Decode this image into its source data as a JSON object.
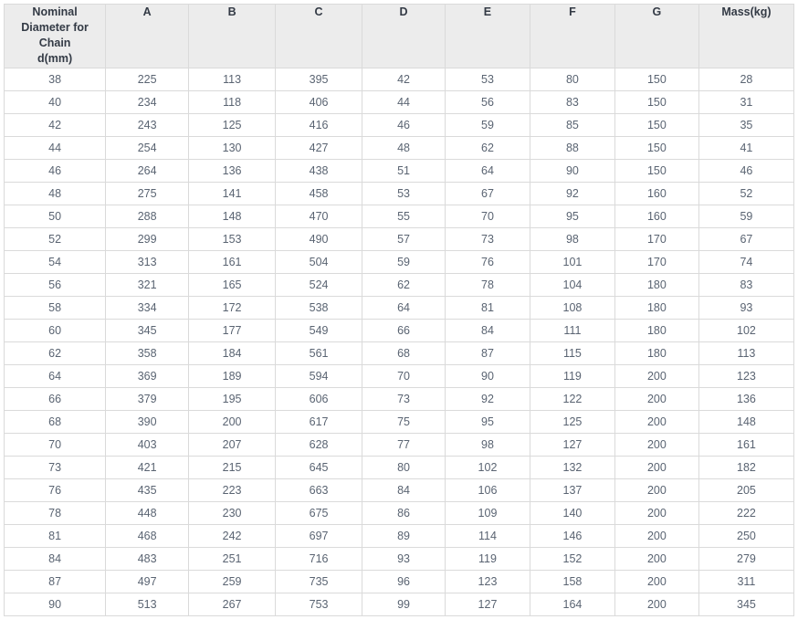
{
  "table": {
    "headers": [
      "Nominal Diameter for Chain d(mm)",
      "A",
      "B",
      "C",
      "D",
      "E",
      "F",
      "G",
      "Mass(kg)"
    ],
    "header_first_lines": [
      "Nominal",
      "Diameter for",
      "Chain",
      "d(mm)"
    ],
    "rows": [
      [
        "38",
        "225",
        "113",
        "395",
        "42",
        "53",
        "80",
        "150",
        "28"
      ],
      [
        "40",
        "234",
        "118",
        "406",
        "44",
        "56",
        "83",
        "150",
        "31"
      ],
      [
        "42",
        "243",
        "125",
        "416",
        "46",
        "59",
        "85",
        "150",
        "35"
      ],
      [
        "44",
        "254",
        "130",
        "427",
        "48",
        "62",
        "88",
        "150",
        "41"
      ],
      [
        "46",
        "264",
        "136",
        "438",
        "51",
        "64",
        "90",
        "150",
        "46"
      ],
      [
        "48",
        "275",
        "141",
        "458",
        "53",
        "67",
        "92",
        "160",
        "52"
      ],
      [
        "50",
        "288",
        "148",
        "470",
        "55",
        "70",
        "95",
        "160",
        "59"
      ],
      [
        "52",
        "299",
        "153",
        "490",
        "57",
        "73",
        "98",
        "170",
        "67"
      ],
      [
        "54",
        "313",
        "161",
        "504",
        "59",
        "76",
        "101",
        "170",
        "74"
      ],
      [
        "56",
        "321",
        "165",
        "524",
        "62",
        "78",
        "104",
        "180",
        "83"
      ],
      [
        "58",
        "334",
        "172",
        "538",
        "64",
        "81",
        "108",
        "180",
        "93"
      ],
      [
        "60",
        "345",
        "177",
        "549",
        "66",
        "84",
        "111",
        "180",
        "102"
      ],
      [
        "62",
        "358",
        "184",
        "561",
        "68",
        "87",
        "115",
        "180",
        "113"
      ],
      [
        "64",
        "369",
        "189",
        "594",
        "70",
        "90",
        "119",
        "200",
        "123"
      ],
      [
        "66",
        "379",
        "195",
        "606",
        "73",
        "92",
        "122",
        "200",
        "136"
      ],
      [
        "68",
        "390",
        "200",
        "617",
        "75",
        "95",
        "125",
        "200",
        "148"
      ],
      [
        "70",
        "403",
        "207",
        "628",
        "77",
        "98",
        "127",
        "200",
        "161"
      ],
      [
        "73",
        "421",
        "215",
        "645",
        "80",
        "102",
        "132",
        "200",
        "182"
      ],
      [
        "76",
        "435",
        "223",
        "663",
        "84",
        "106",
        "137",
        "200",
        "205"
      ],
      [
        "78",
        "448",
        "230",
        "675",
        "86",
        "109",
        "140",
        "200",
        "222"
      ],
      [
        "81",
        "468",
        "242",
        "697",
        "89",
        "114",
        "146",
        "200",
        "250"
      ],
      [
        "84",
        "483",
        "251",
        "716",
        "93",
        "119",
        "152",
        "200",
        "279"
      ],
      [
        "87",
        "497",
        "259",
        "735",
        "96",
        "123",
        "158",
        "200",
        "311"
      ],
      [
        "90",
        "513",
        "267",
        "753",
        "99",
        "127",
        "164",
        "200",
        "345"
      ]
    ]
  },
  "colors": {
    "header_background": "#ececec",
    "header_text": "#333a45",
    "cell_text": "#5a6472",
    "border": "#dadada",
    "cell_background": "#ffffff"
  }
}
